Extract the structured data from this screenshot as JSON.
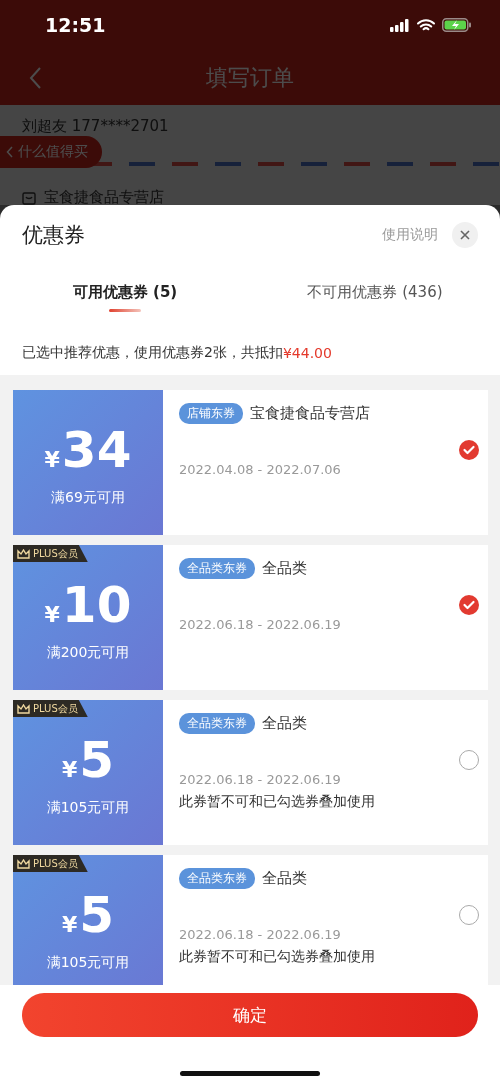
{
  "status_bar": {
    "time": "12:51"
  },
  "background_page": {
    "title": "填写订单",
    "contact": "刘超友 177****2701",
    "float_button": "什么值得买",
    "store": "宝食捷食品专营店"
  },
  "sheet": {
    "title": "优惠券",
    "help_link": "使用说明",
    "tabs": [
      {
        "label": "可用优惠券 (5)",
        "selected": true
      },
      {
        "label": "不可用优惠券 (436)",
        "selected": false
      }
    ],
    "summary": {
      "text": "已选中推荐优惠，使用优惠券2张，共抵扣",
      "amount": "¥44.00"
    },
    "coupons": [
      {
        "currency": "¥",
        "amount": "34",
        "condition": "满69元可用",
        "plus": false,
        "tag": "店铺东券",
        "scope": "宝食捷食品专营店",
        "dates": "2022.04.08 - 2022.07.06",
        "selected": true
      },
      {
        "currency": "¥",
        "amount": "10",
        "condition": "满200元可用",
        "plus": true,
        "plus_label": "PLUS会员",
        "tag": "全品类东券",
        "scope": "全品类",
        "dates": "2022.06.18 - 2022.06.19",
        "selected": true
      },
      {
        "currency": "¥",
        "amount": "5",
        "condition": "满105元可用",
        "plus": true,
        "plus_label": "PLUS会员",
        "tag": "全品类东券",
        "scope": "全品类",
        "dates": "2022.06.18 - 2022.06.19",
        "note": "此券暂不可和已勾选券叠加使用",
        "selected": false
      },
      {
        "currency": "¥",
        "amount": "5",
        "condition": "满105元可用",
        "plus": true,
        "plus_label": "PLUS会员",
        "tag": "全品类东券",
        "scope": "全品类",
        "dates": "2022.06.18 - 2022.06.19",
        "note": "此券暂不可和已勾选券叠加使用",
        "selected": false
      }
    ],
    "confirm_button": "确定"
  }
}
